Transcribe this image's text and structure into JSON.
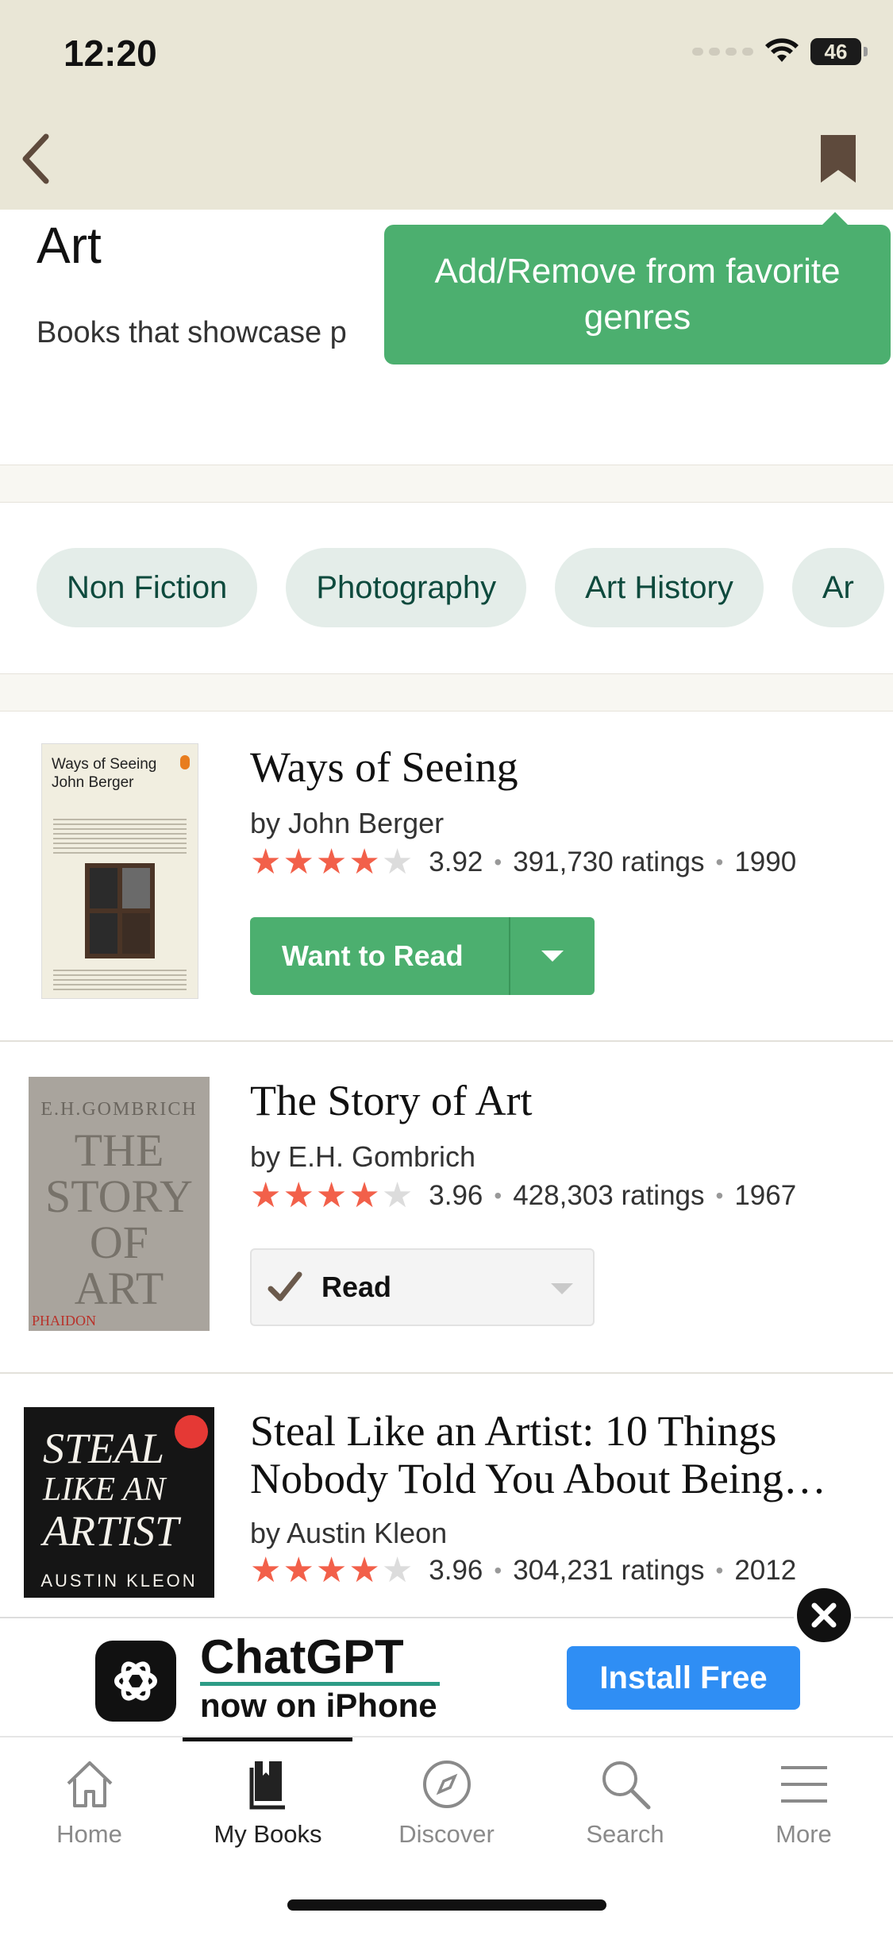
{
  "status_bar": {
    "time": "12:20",
    "battery": "46"
  },
  "header": {
    "genre_title": "Art",
    "genre_description": "Books that showcase p",
    "tooltip": "Add/Remove from favorite genres"
  },
  "chips": [
    "Non Fiction",
    "Photography",
    "Art History",
    "Ar"
  ],
  "books": [
    {
      "title": "Ways of Seeing",
      "author": "by John Berger",
      "rating": "3.92",
      "ratings_count": "391,730 ratings",
      "year": "1990",
      "stars_filled": 4,
      "shelf_button": "Want to Read",
      "cover_title": "Ways of Seeing",
      "cover_author": "John Berger"
    },
    {
      "title": "The Story of Art",
      "author": "by E.H. Gombrich",
      "rating": "3.96",
      "ratings_count": "428,303 ratings",
      "year": "1967",
      "stars_filled": 4,
      "shelf_button": "Read",
      "cover_author": "E.H.GOMBRICH",
      "cover_title_lines": [
        "THE",
        "STORY",
        "OF",
        "ART"
      ],
      "cover_publisher": "PHAIDON"
    },
    {
      "title": "Steal Like an Artist: 10 Things Nobody Told You About Being…",
      "author": "by Austin Kleon",
      "rating": "3.96",
      "ratings_count": "304,231 ratings",
      "year": "2012",
      "stars_filled": 4,
      "cover_title_lines": [
        "STEAL",
        "LIKE AN",
        "ARTIST"
      ],
      "cover_author": "AUSTIN KLEON"
    }
  ],
  "ad": {
    "name": "ChatGPT",
    "subtitle": "now on iPhone",
    "button": "Install Free"
  },
  "tabs": [
    {
      "label": "Home",
      "icon": "home-icon"
    },
    {
      "label": "My Books",
      "icon": "book-icon",
      "active": true
    },
    {
      "label": "Discover",
      "icon": "compass-icon"
    },
    {
      "label": "Search",
      "icon": "search-icon"
    },
    {
      "label": "More",
      "icon": "menu-icon"
    }
  ],
  "colors": {
    "topbar": "#e9e6d6",
    "accent_green": "#4caf6f",
    "star": "#f2604a",
    "chip_bg": "#e4ede9",
    "chip_text": "#0e4a3d",
    "bookmark": "#5e4a3c"
  }
}
